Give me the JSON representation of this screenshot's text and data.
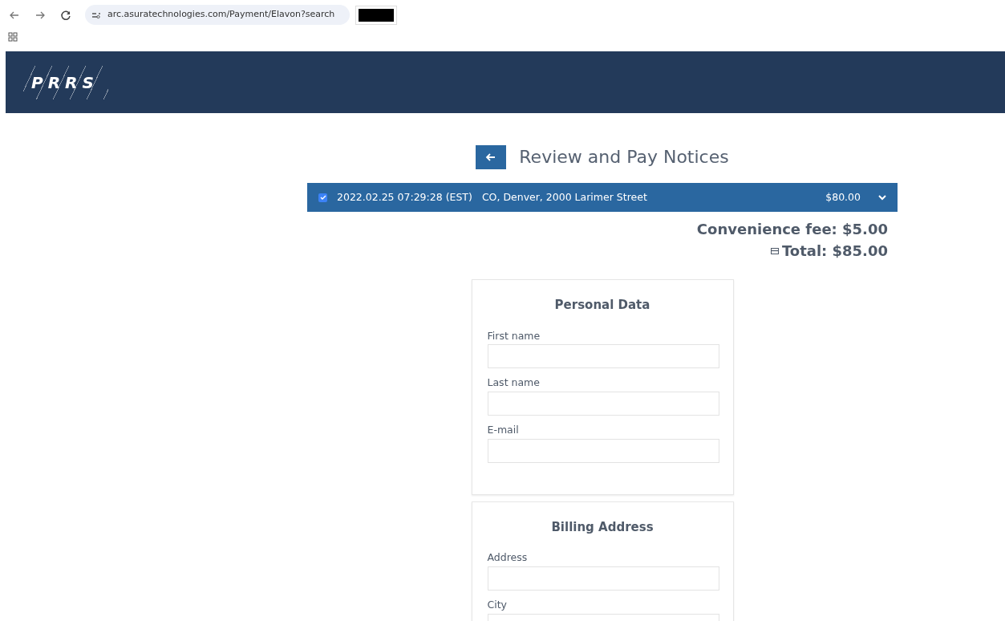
{
  "browser": {
    "url": "arc.asuratechnologies.com/Payment/Elavon?search"
  },
  "header": {
    "logo": "PRRS"
  },
  "page": {
    "title": "Review and Pay Notices"
  },
  "notices": [
    {
      "checked": true,
      "datetime": "2022.02.25 07:29:28 (EST)",
      "location": "CO, Denver, 2000 Larimer Street",
      "amount": "$80.00",
      "expanded": false
    }
  ],
  "fees": {
    "convenience": "Convenience fee: $5.00",
    "total": "Total: $85.00"
  },
  "sections": [
    {
      "title": "Personal Data",
      "fields": [
        {
          "label": "First name"
        },
        {
          "label": "Last name"
        },
        {
          "label": "E-mail"
        }
      ]
    },
    {
      "title": "Billing Address",
      "fields": [
        {
          "label": "Address"
        },
        {
          "label": "City"
        }
      ]
    }
  ]
}
